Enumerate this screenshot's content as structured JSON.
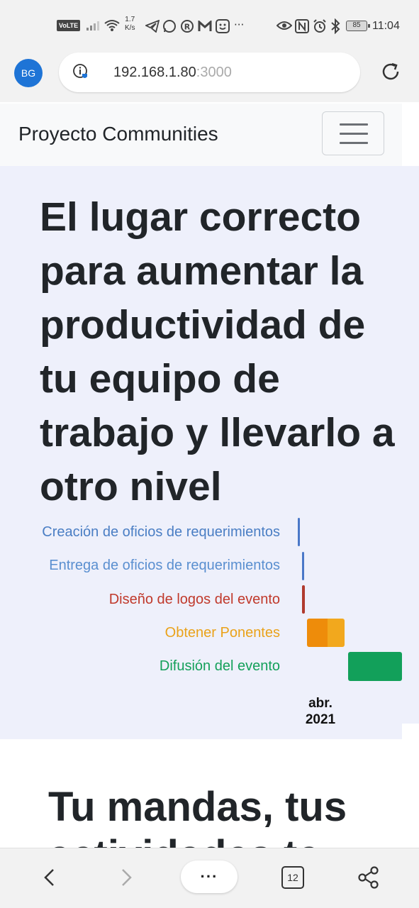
{
  "status_bar": {
    "volte": "VoLTE",
    "net_speed": "1.7",
    "net_speed_unit": "K/s",
    "battery": "85",
    "time": "11:04",
    "icons": [
      "signal-icon",
      "wifi-icon",
      "telegram-icon",
      "whatsapp-icon",
      "registered-icon",
      "gmail-icon",
      "face-app-icon",
      "more-dots-icon",
      "eye-icon",
      "nfc-icon",
      "alarm-icon",
      "bluetooth-icon",
      "battery-icon"
    ]
  },
  "browser": {
    "avatar_initials": "BG",
    "url_host": "192.168.1.80",
    "url_port": ":3000",
    "tab_count": "12",
    "menu_label": "···"
  },
  "navbar": {
    "brand": "Proyecto Communities"
  },
  "hero": {
    "title": "El lugar correcto para aumentar la productividad de tu equipo de trabajo y llevarlo a otro nivel"
  },
  "chart_data": {
    "type": "timeline",
    "axis_label": "abr. 2021",
    "axis_label_line1": "abr.",
    "axis_label_line2": "2021",
    "tasks": [
      {
        "name": "Creación de oficios de requerimientos",
        "color": "#4a78c8",
        "start_frac": 0.0,
        "end_frac": 0.02
      },
      {
        "name": "Entrega de oficios de requerimientos",
        "color": "#4a78c8",
        "start_frac": 0.04,
        "end_frac": 0.06
      },
      {
        "name": "Diseño de logos del evento",
        "color": "#b03a2e",
        "start_frac": 0.04,
        "end_frac": 0.07
      },
      {
        "name": "Obtener Ponentes",
        "color": "#f0a21a",
        "start_frac": 0.09,
        "end_frac": 0.45
      },
      {
        "name": "Difusión del evento",
        "color": "#12a05a",
        "start_frac": 0.48,
        "end_frac": 1.0
      }
    ],
    "label_colors": [
      "#4a7ec4",
      "#5a8fd0",
      "#c0392b",
      "#eaa21a",
      "#14a05a"
    ]
  },
  "section2": {
    "title": "Tu mandas, tus actividades te"
  }
}
